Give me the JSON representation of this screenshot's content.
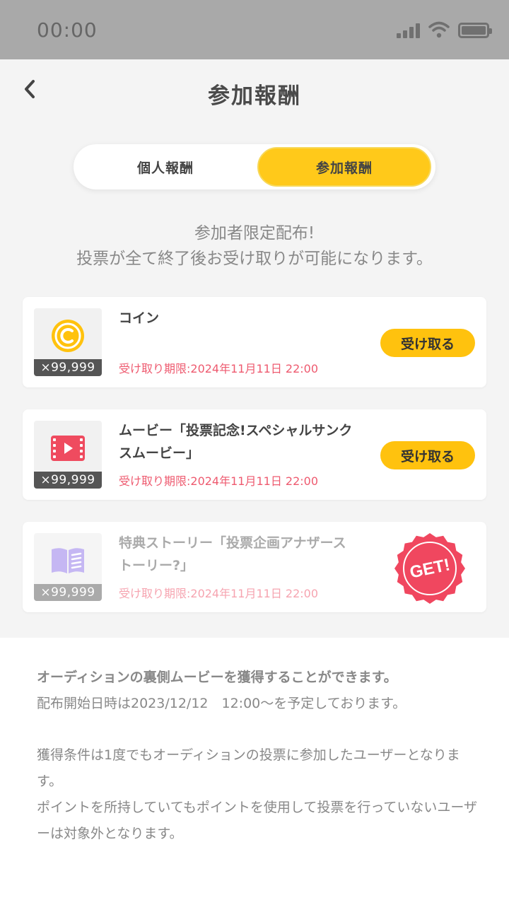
{
  "status_bar": {
    "time": "00:00",
    "icons": [
      "signal-icon",
      "wifi-icon",
      "battery-icon"
    ]
  },
  "header": {
    "back_icon": "chevron-left-icon",
    "title": "参加報酬"
  },
  "tabs": [
    {
      "label": "個人報酬",
      "active": false
    },
    {
      "label": "参加報酬",
      "active": true
    }
  ],
  "notice": {
    "line1": "参加者限定配布!",
    "line2": "投票が全て終了後お受け取りが可能になります。"
  },
  "rewards": [
    {
      "icon": "coin-icon",
      "quantity": "×99,999",
      "name": "コイン",
      "deadline": "受け取り期限:2024年11月11日 22:00",
      "action": "受け取る",
      "received": false
    },
    {
      "icon": "movie-icon",
      "quantity": "×99,999",
      "name": "ムービー「投票記念!スペシャルサンクスムービー」",
      "deadline": "受け取り期限:2024年11月11日 22:00",
      "action": "受け取る",
      "received": false
    },
    {
      "icon": "book-icon",
      "quantity": "×99,999",
      "name": "特典ストーリー「投票企画アナザーストーリー?」",
      "deadline": "受け取り期限:2024年11月11日 22:00",
      "stamp": "GET!",
      "received": true
    }
  ],
  "info": {
    "p1_line1": "オーディションの裏側ムービーを獲得することができます。",
    "p1_line2": "配布開始日時は2023/12/12　12:00〜を予定しております。",
    "p2": "獲得条件は1度でもオーディションの投票に参加したユーザーとなります。",
    "p3": "ポイントを所持していてもポイントを使用して投票を行っていないユーザーは対象外となります。"
  },
  "colors": {
    "accent": "#ffc20e",
    "deadline": "#ee5a6f",
    "stamp": "#f0475f",
    "movie": "#ef4b5f",
    "book": "#c5b7f3",
    "coin": "#ffc20e"
  }
}
